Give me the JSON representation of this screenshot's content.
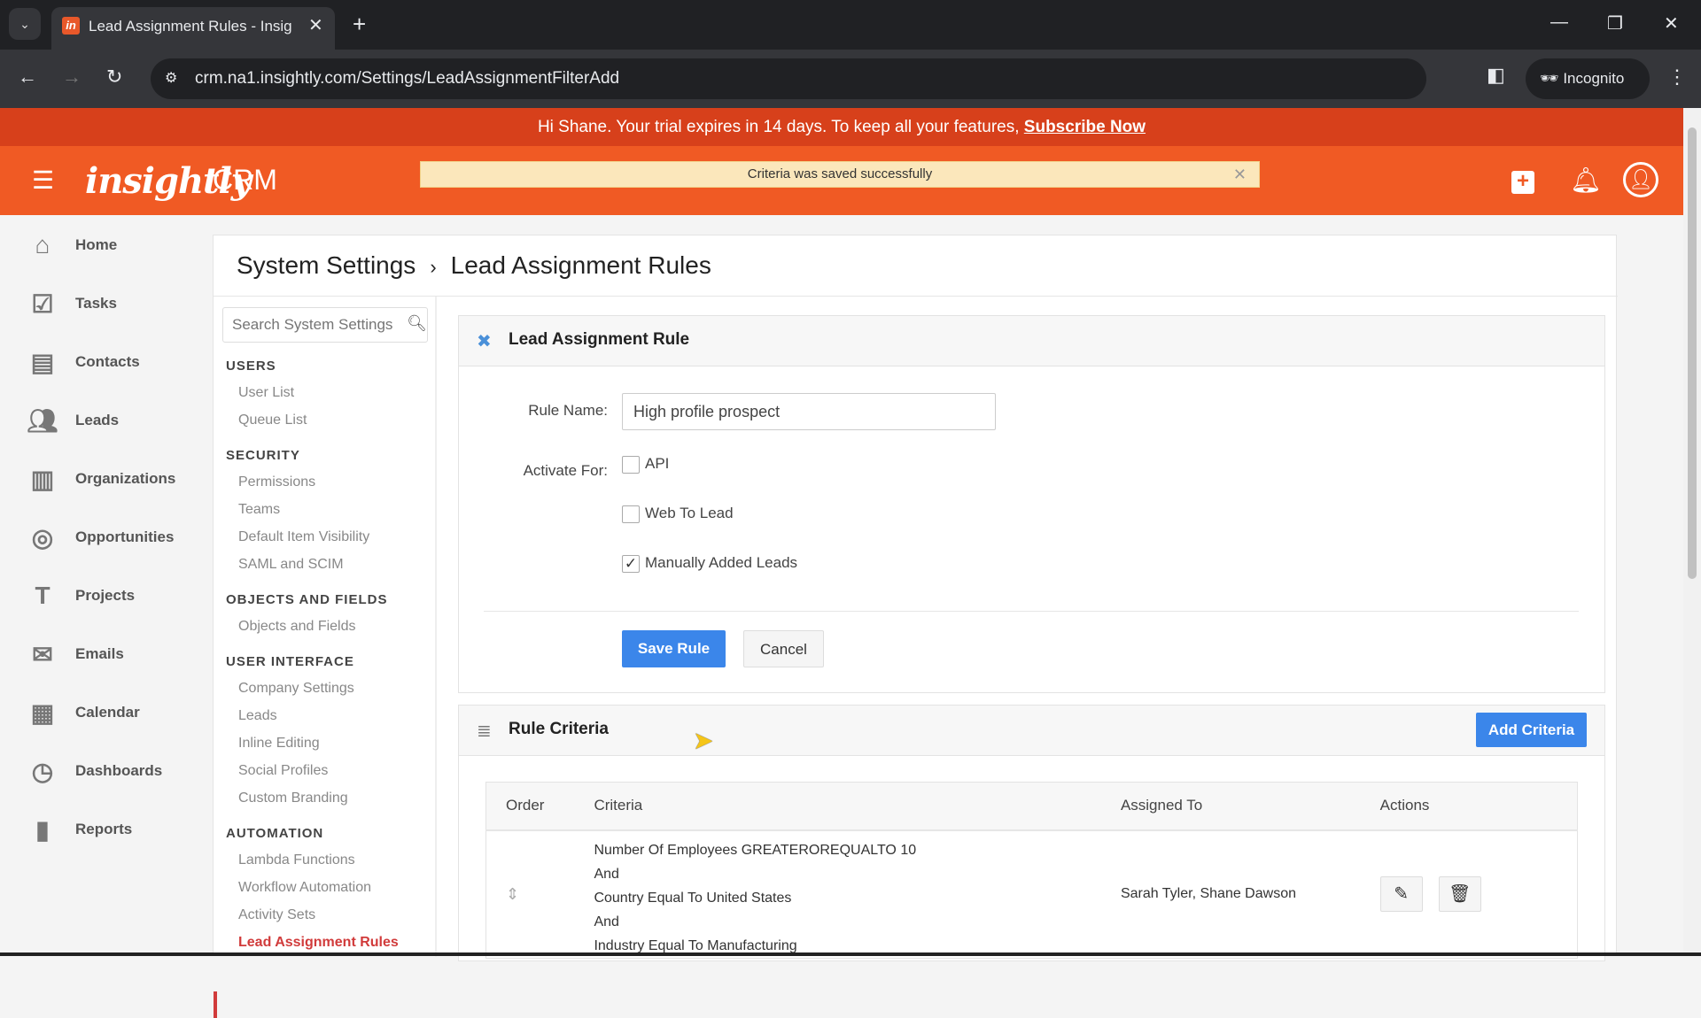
{
  "browser": {
    "tab_title": "Lead Assignment Rules - Insightly",
    "url": "crm.na1.insightly.com/Settings/LeadAssignmentFilterAdd",
    "incognito_label": "Incognito"
  },
  "banner": {
    "text": "Hi Shane. Your trial expires in 14 days. To keep all your features,",
    "link": "Subscribe Now"
  },
  "header": {
    "logo": "insightly",
    "product": "CRM",
    "toast": "Criteria was saved successfully"
  },
  "sidebar": {
    "items": [
      {
        "label": "Home",
        "icon": "home-icon"
      },
      {
        "label": "Tasks",
        "icon": "tasks-icon"
      },
      {
        "label": "Contacts",
        "icon": "contacts-icon"
      },
      {
        "label": "Leads",
        "icon": "leads-icon"
      },
      {
        "label": "Organizations",
        "icon": "organizations-icon"
      },
      {
        "label": "Opportunities",
        "icon": "opportunities-icon"
      },
      {
        "label": "Projects",
        "icon": "projects-icon"
      },
      {
        "label": "Emails",
        "icon": "emails-icon"
      },
      {
        "label": "Calendar",
        "icon": "calendar-icon"
      },
      {
        "label": "Dashboards",
        "icon": "dashboards-icon"
      },
      {
        "label": "Reports",
        "icon": "reports-icon"
      }
    ]
  },
  "breadcrumb": {
    "parent": "System Settings",
    "separator": "›",
    "current": "Lead Assignment Rules"
  },
  "settings_nav": {
    "search_placeholder": "Search System Settings",
    "sections": [
      {
        "heading": "USERS",
        "items": [
          "User List",
          "Queue List"
        ]
      },
      {
        "heading": "SECURITY",
        "items": [
          "Permissions",
          "Teams",
          "Default Item Visibility",
          "SAML and SCIM"
        ]
      },
      {
        "heading": "OBJECTS AND FIELDS",
        "items": [
          "Objects and Fields"
        ]
      },
      {
        "heading": "USER INTERFACE",
        "items": [
          "Company Settings",
          "Leads",
          "Inline Editing",
          "Social Profiles",
          "Custom Branding"
        ]
      },
      {
        "heading": "AUTOMATION",
        "items": [
          "Lambda Functions",
          "Workflow Automation",
          "Activity Sets",
          "Lead Assignment Rules"
        ]
      }
    ]
  },
  "rule_form": {
    "title": "Lead Assignment Rule",
    "rule_name_label": "Rule Name:",
    "rule_name_value": "High profile prospect",
    "activate_label": "Activate For:",
    "options": [
      {
        "label": "API",
        "checked": false
      },
      {
        "label": "Web To Lead",
        "checked": false
      },
      {
        "label": "Manually Added Leads",
        "checked": true
      }
    ],
    "save_label": "Save Rule",
    "cancel_label": "Cancel"
  },
  "criteria": {
    "title": "Rule Criteria",
    "add_label": "Add Criteria",
    "columns": [
      "Order",
      "Criteria",
      "Assigned To",
      "Actions"
    ],
    "rows": [
      {
        "criteria": [
          "Number Of Employees GREATEROREQUALTO 10",
          "And",
          "Country Equal To United States",
          "And",
          "Industry Equal To Manufacturing"
        ],
        "assigned_to": "Sarah Tyler, Shane Dawson"
      }
    ]
  }
}
